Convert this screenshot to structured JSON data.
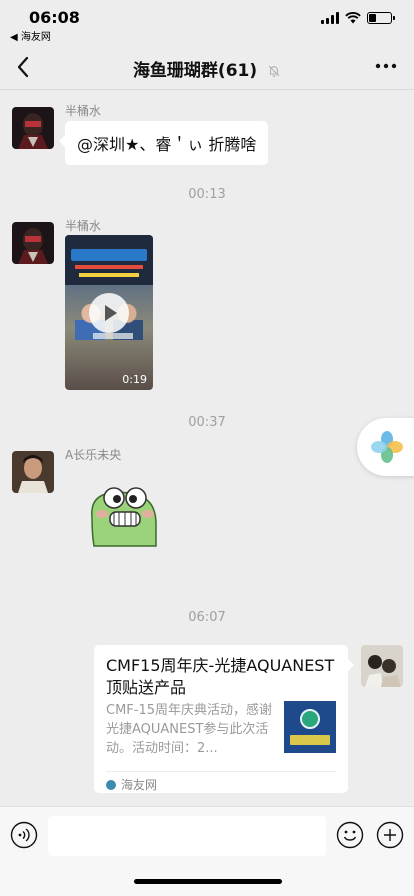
{
  "status_bar": {
    "time": "06:08",
    "back_app": "◀ 海友网",
    "battery_level": 0.35
  },
  "nav": {
    "title": "海鱼珊瑚群(61)"
  },
  "messages": [
    {
      "sender": "半桶水",
      "text": "@深圳★、睿＇ぃ  折腾啥"
    },
    {
      "timestamp": "00:13"
    },
    {
      "sender": "半桶水",
      "video_duration": "0:19"
    },
    {
      "timestamp": "00:37"
    },
    {
      "sender": "A长乐未央"
    },
    {
      "timestamp": "06:07"
    },
    {
      "link_title": "CMF15周年庆-光捷AQUANEST顶贴送产品",
      "link_desc": "CMF-15周年庆典活动，感谢光捷AQUANEST参与此次活动。活动时间：2...",
      "link_source": "海友网"
    }
  ]
}
